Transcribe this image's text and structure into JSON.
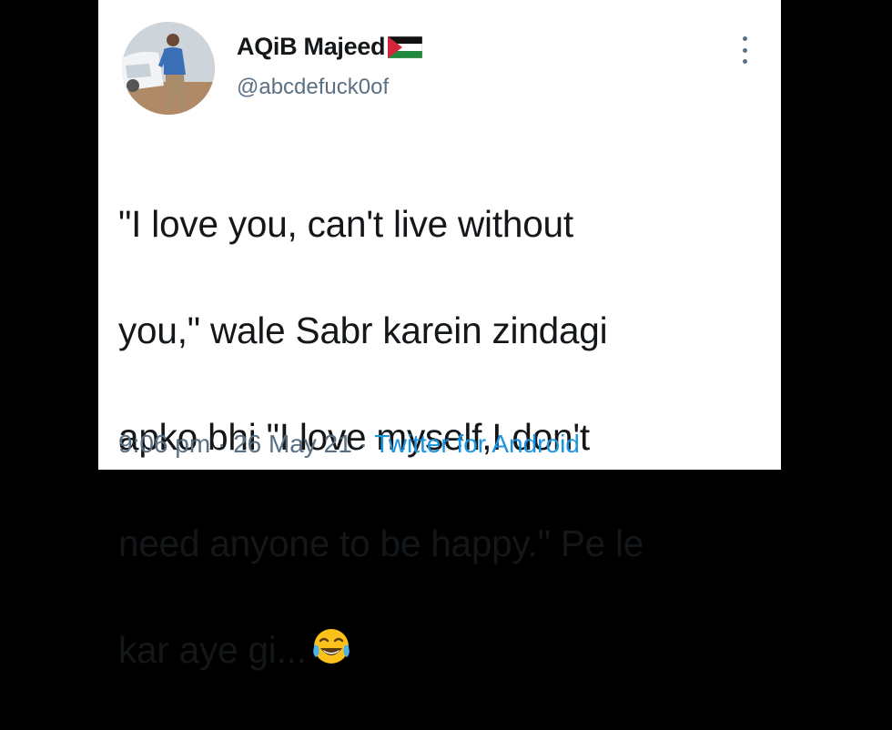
{
  "tweet": {
    "author_name": "AQiB Majeed",
    "handle": "@abcdefuck0of",
    "text_lines": [
      "\"I love you, can't live without",
      "you,\" wale Sabr karein zindagi",
      "apko bhi \"I love myself,I don't",
      "need anyone to be happy.\" Pe le",
      "kar aye gi..."
    ],
    "time": "9:06 pm",
    "date": "26 May 21",
    "source": "Twitter for Android",
    "separator": "·"
  },
  "icons": {
    "flag": "palestine-flag-icon",
    "emoji": "face-with-tears-of-joy-icon",
    "more": "more-vertical-icon"
  },
  "colors": {
    "text": "#14171a",
    "secondary": "#5b7083",
    "link": "#1b95e0",
    "card": "#ffffff",
    "background": "#000000"
  }
}
